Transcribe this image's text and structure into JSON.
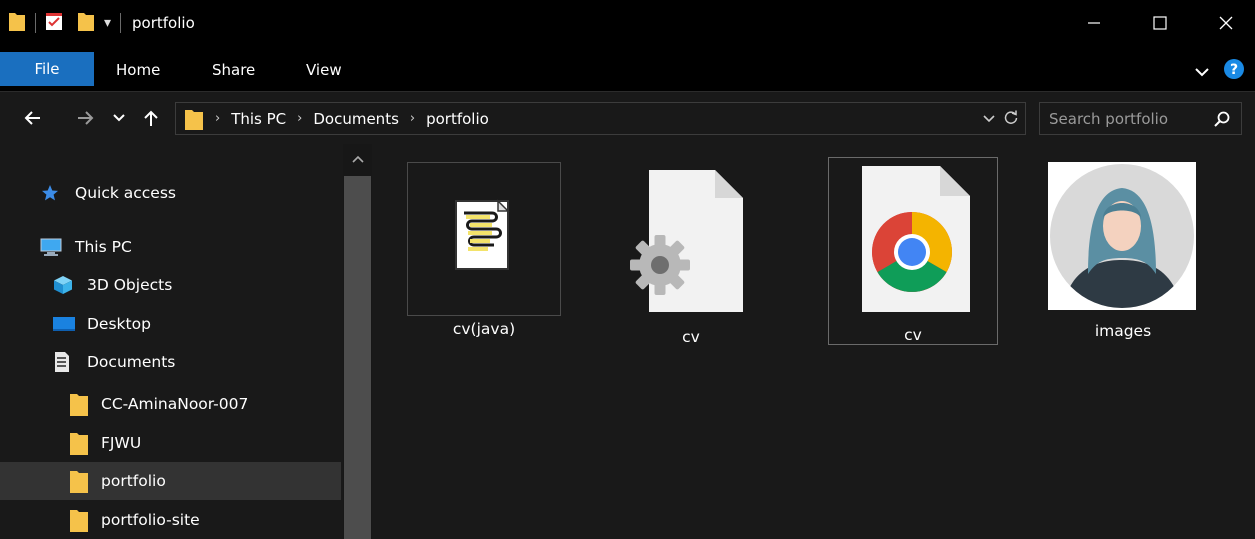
{
  "window": {
    "title": "portfolio",
    "qat_dropdown_glyph": "▾"
  },
  "ribbon": {
    "tabs": [
      {
        "label": "File",
        "active": true
      },
      {
        "label": "Home"
      },
      {
        "label": "Share"
      },
      {
        "label": "View"
      }
    ]
  },
  "address": {
    "crumbs": [
      "This PC",
      "Documents",
      "portfolio"
    ]
  },
  "search": {
    "placeholder": "Search portfolio"
  },
  "navigation": {
    "items": [
      {
        "label": "Quick access",
        "icon": "star-icon"
      },
      {
        "label": "This PC",
        "icon": "computer-icon"
      },
      {
        "label": "3D Objects",
        "icon": "cube-icon"
      },
      {
        "label": "Desktop",
        "icon": "desktop-icon"
      },
      {
        "label": "Documents",
        "icon": "documents-icon"
      },
      {
        "label": "CC-AminaNoor-007",
        "icon": "folder-icon"
      },
      {
        "label": "FJWU",
        "icon": "folder-icon"
      },
      {
        "label": "portfolio",
        "icon": "folder-icon",
        "selected": true
      },
      {
        "label": "portfolio-site",
        "icon": "folder-icon"
      }
    ]
  },
  "files": [
    {
      "name": "cv(java)",
      "icon": "java-script-file-icon"
    },
    {
      "name": "cv",
      "icon": "settings-file-icon"
    },
    {
      "name": "cv",
      "icon": "chrome-html-file-icon"
    },
    {
      "name": "images",
      "icon": "image-thumbnail"
    }
  ],
  "colors": {
    "accent": "#1a6fbf",
    "folder": "#f5c24a",
    "background": "#191919",
    "selected": "#333333"
  }
}
